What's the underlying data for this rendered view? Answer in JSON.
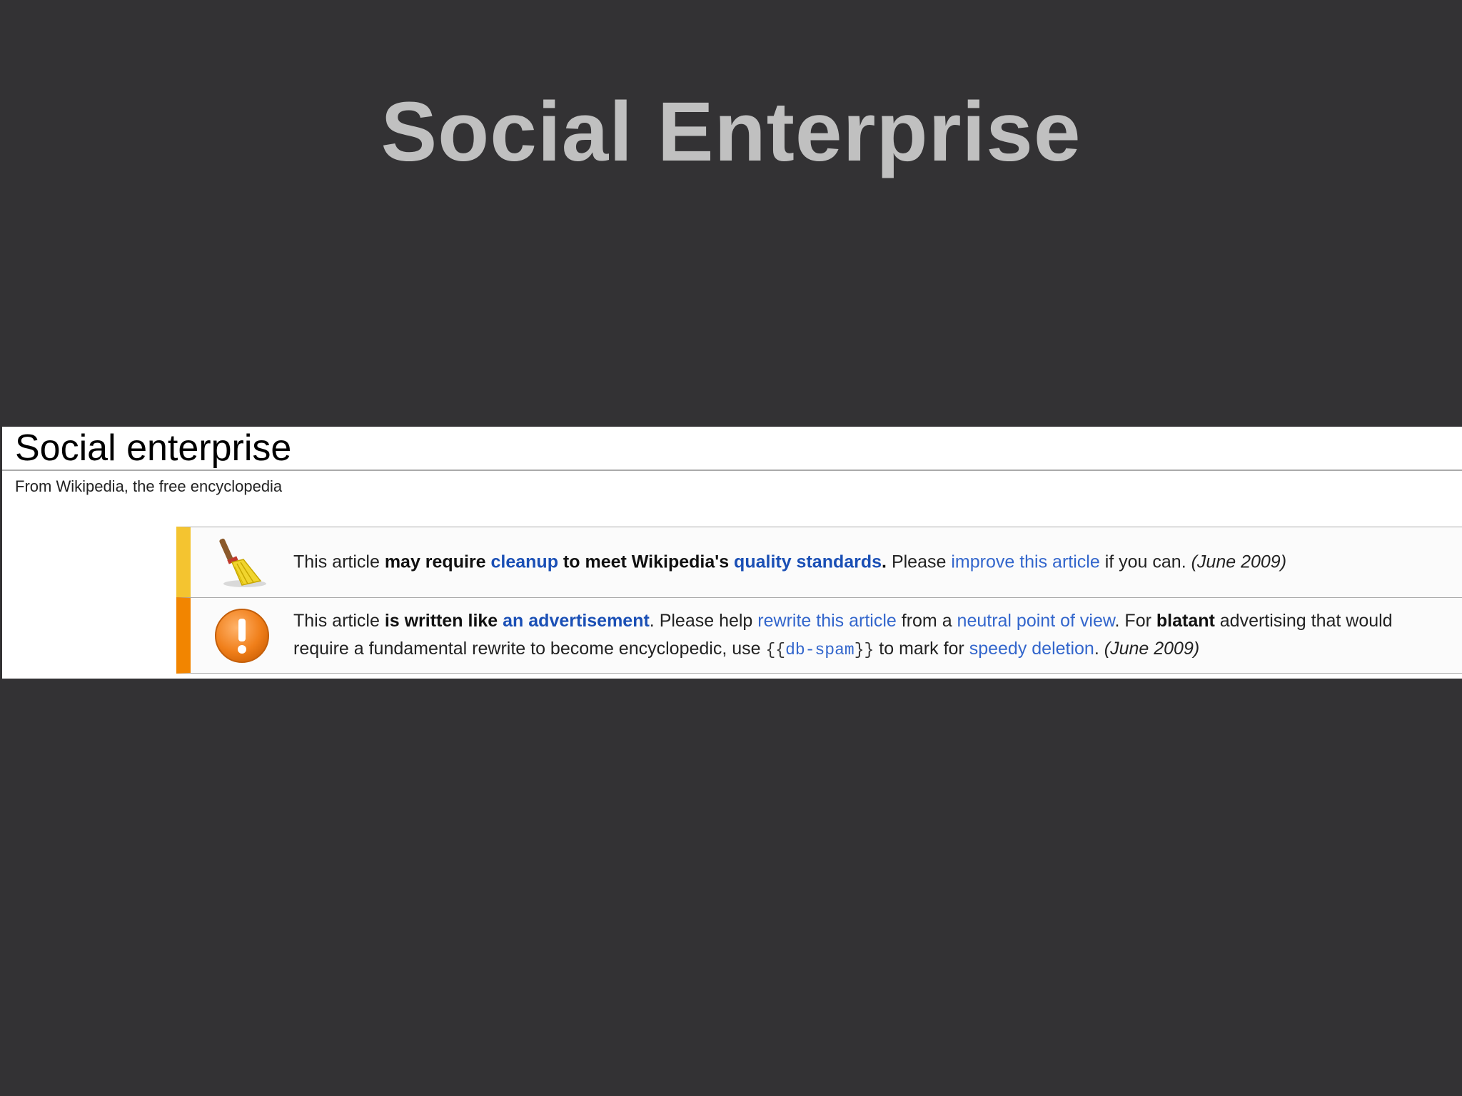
{
  "slide": {
    "title": "Social Enterprise"
  },
  "wiki": {
    "heading": "Social enterprise",
    "tagline": "From Wikipedia, the free encyclopedia",
    "cleanup_notice": {
      "icon": "broom-icon",
      "accent_color": "#f4c430",
      "t1": "This article ",
      "t2": "may require ",
      "link_cleanup": "cleanup",
      "t3": " to meet Wikipedia's ",
      "link_quality": "quality standards",
      "t4": ".",
      "t5": " Please ",
      "link_improve": "improve this article",
      "t6": " if you can. ",
      "date": "(June 2009)"
    },
    "advert_notice": {
      "icon": "warning-exclamation-icon",
      "accent_color": "#f28500",
      "t1": "This article ",
      "t2": "is written like ",
      "link_advert": "an advertisement",
      "t3": ". Please help ",
      "link_rewrite": "rewrite this article",
      "t4": " from a ",
      "link_npov": "neutral point of view",
      "t5": ". For ",
      "t6": "blatant",
      "t7": " advertising that would require a fundamental rewrite to become encyclopedic, use ",
      "code_open": "{{",
      "code_link": "db-spam",
      "code_close": "}}",
      "t8": " to mark for ",
      "link_speedy": "speedy deletion",
      "t9": ". ",
      "date": "(June 2009)"
    }
  }
}
